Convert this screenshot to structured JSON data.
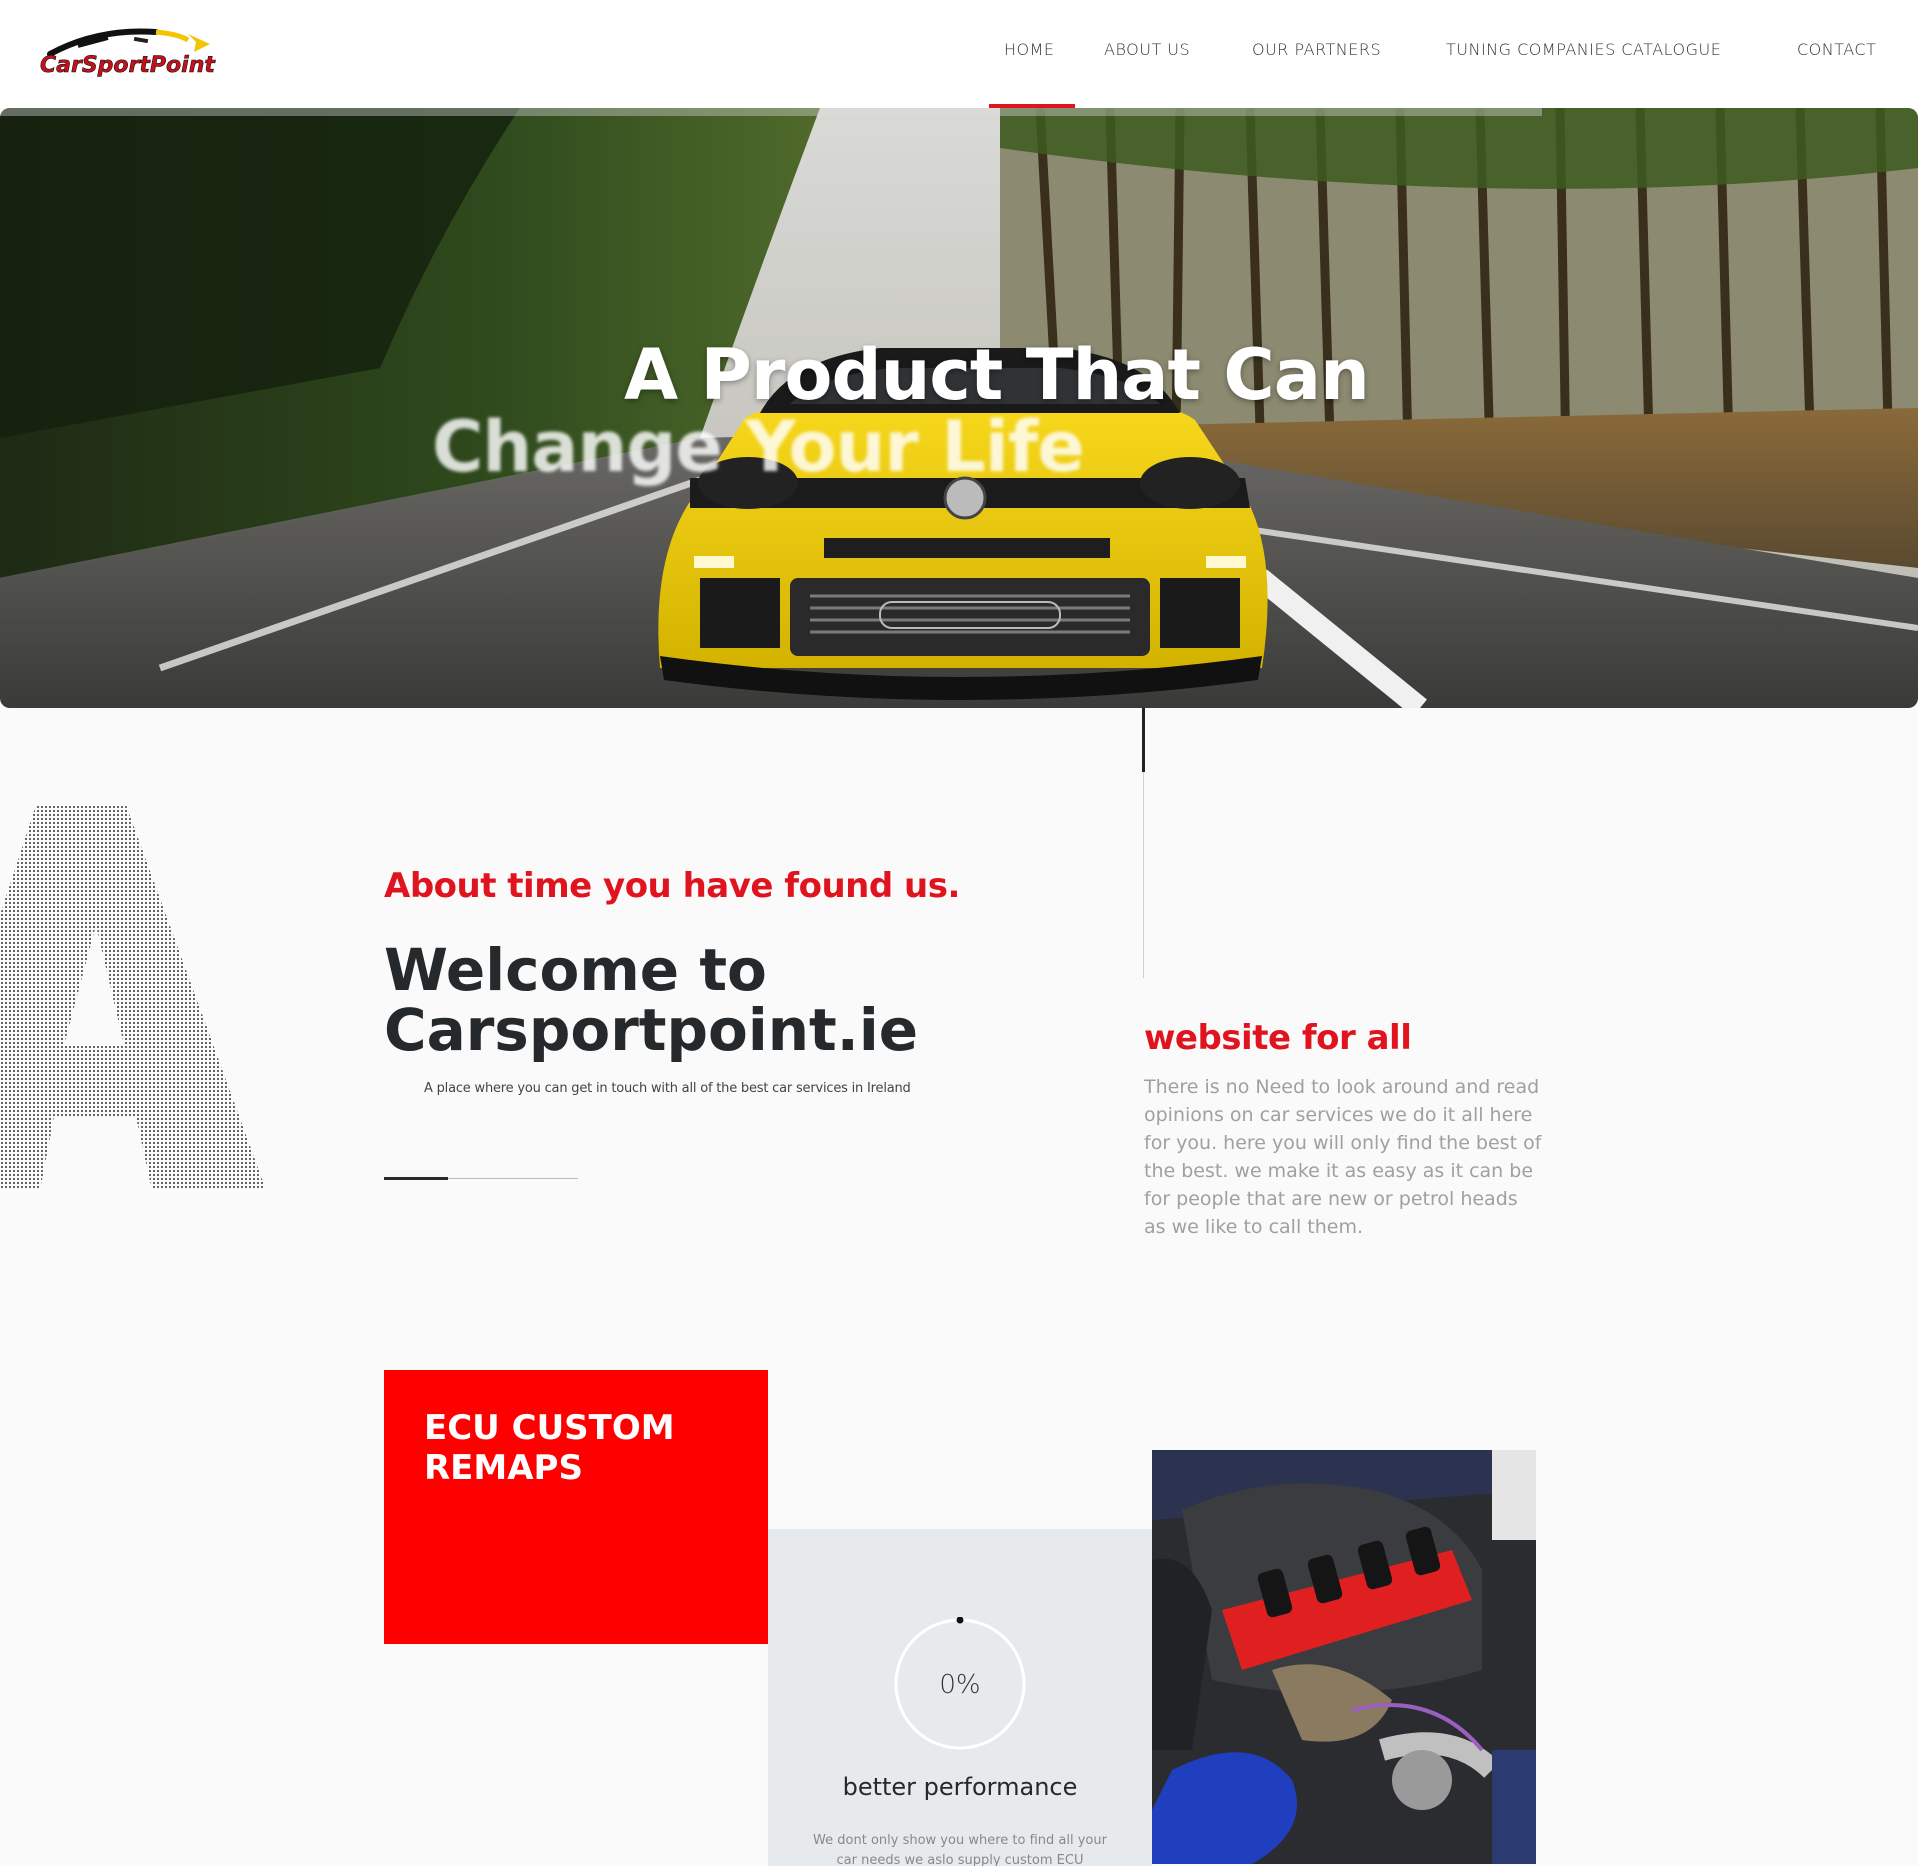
{
  "header": {
    "logo_text": "CarSportPoint",
    "nav": [
      {
        "label": "HOME",
        "active": true
      },
      {
        "label": "ABOUT US",
        "active": false
      },
      {
        "label": "OUR PARTNERS",
        "active": false
      },
      {
        "label": "TUNING COMPANIES CATALOGUE",
        "active": false
      },
      {
        "label": "CONTACT",
        "active": false
      }
    ]
  },
  "hero": {
    "title_line1": "A Product That Can",
    "title_line2": "Change Your Life"
  },
  "about": {
    "eyebrow": "About time you have found us.",
    "title": "Welcome to\nCarsportpoint.ie",
    "description": "A place where you can get in touch with all of the best car services in Ireland",
    "side_title": "website for all",
    "side_text": "There is no Need to look around and read opinions on car services we do it all here for you. here you will only find the best of the best. we make it as easy as it can be for people that are new or petrol heads as we like to call them."
  },
  "services": {
    "card_title": "ECU CUSTOM REMAPS",
    "counter_value": "0%",
    "counter_progress": 0,
    "perf_title": "better performance",
    "perf_text": "We dont only show you where to find all your car needs we aslo supply custom ECU"
  },
  "colors": {
    "accent": "#e0141e",
    "red_box": "#ff0000",
    "dark_text": "#25292b",
    "muted_text": "#a0a0a0",
    "grey_panel": "#e7eaec"
  },
  "icons": {
    "logo": "carsportpoint-logo"
  }
}
